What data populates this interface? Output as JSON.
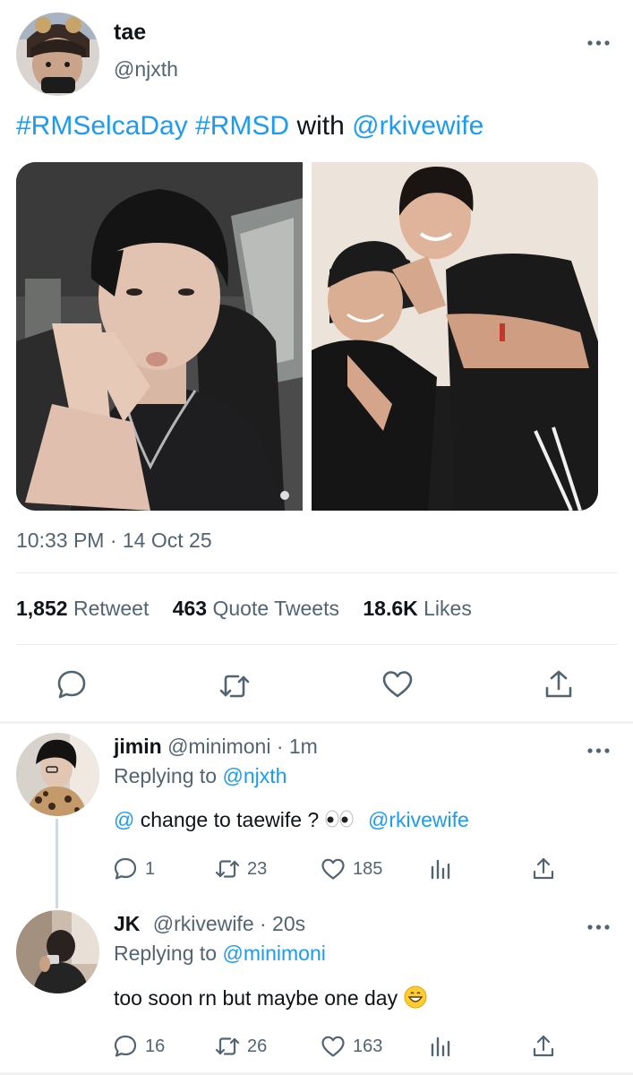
{
  "tweet": {
    "display_name": "tae",
    "handle": "@njxth",
    "text_parts": {
      "hashtag1": "#RMSelcaDay",
      "hashtag2": "#RMSD",
      "with": "with",
      "mention": "@rkivewife"
    },
    "timestamp": "10:33 PM · 14 Oct 25",
    "stats": {
      "retweets_count": "1,852",
      "retweets_label": "Retweet",
      "quotes_count": "463",
      "quotes_label": "Quote Tweets",
      "likes_count": "18.6K",
      "likes_label": "Likes"
    },
    "actions": [
      "reply-icon",
      "retweet-icon",
      "like-icon",
      "share-icon"
    ]
  },
  "replies": [
    {
      "display_name": "jimin",
      "handle": "@minimoni",
      "time": "· 1m",
      "replying_label": "Replying to",
      "replying_to": "@njxth",
      "body": {
        "mention_start": "@",
        "text": " change to taewife ? ",
        "emoji_name": "eyes-emoji",
        "mention_end": "@rkivewife"
      },
      "counts": {
        "replies": "1",
        "retweets": "23",
        "likes": "185"
      }
    },
    {
      "display_name": "JK",
      "handle": "@rkivewife",
      "time": "· 20s",
      "replying_label": "Replying to",
      "replying_to": "@minimoni",
      "body": {
        "text": "too soon rn but maybe one day",
        "emoji_name": "grinning-emoji"
      },
      "counts": {
        "replies": "16",
        "retweets": "26",
        "likes": "163"
      }
    }
  ],
  "colors": {
    "accent": "#1d9bf0",
    "secondary_text": "#536471",
    "text": "#0f1419",
    "divider": "#e6ecf0"
  }
}
